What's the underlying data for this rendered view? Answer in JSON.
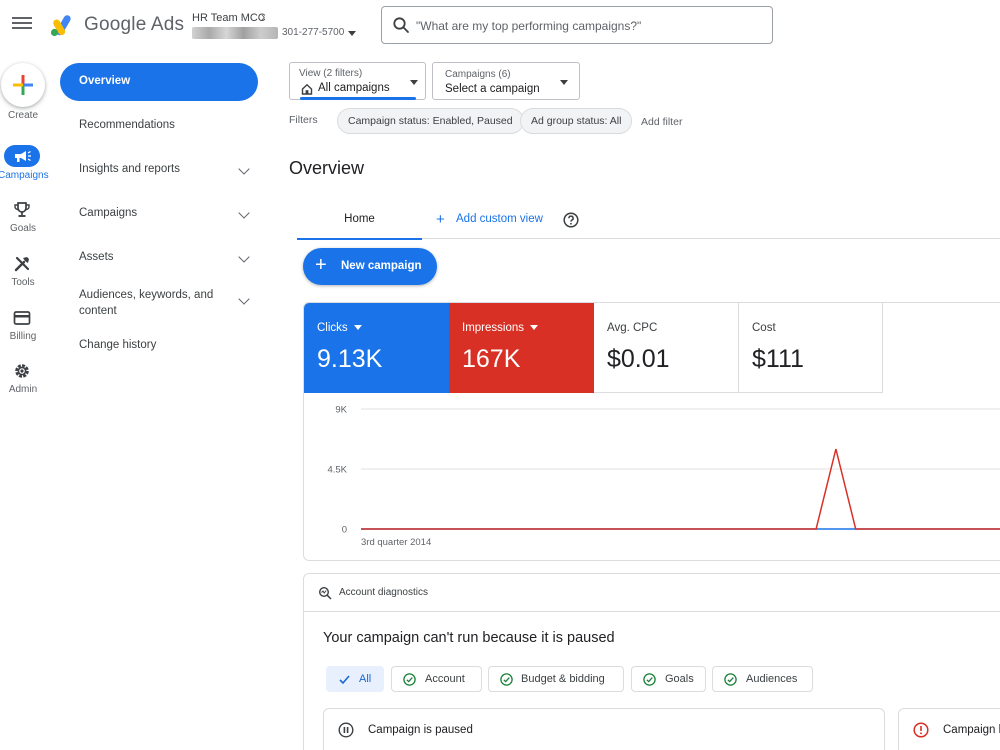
{
  "header": {
    "product_name": "Google Ads",
    "account_name": "HR Team MCC",
    "account_id": "301-277-5700",
    "search_placeholder": "\"What are my top performing campaigns?\""
  },
  "rail": {
    "create": "Create",
    "campaigns": "Campaigns",
    "goals": "Goals",
    "tools": "Tools",
    "billing": "Billing",
    "admin": "Admin"
  },
  "sidenav": {
    "items": [
      {
        "label": "Overview"
      },
      {
        "label": "Recommendations"
      },
      {
        "label": "Insights and reports"
      },
      {
        "label": "Campaigns"
      },
      {
        "label": "Assets"
      },
      {
        "label": "Audiences, keywords, and content"
      },
      {
        "label": "Change history"
      }
    ]
  },
  "selectors": {
    "view_label": "View (2 filters)",
    "view_value": "All campaigns",
    "campaigns_label": "Campaigns (6)",
    "campaigns_value": "Select a campaign"
  },
  "filters": {
    "label": "Filters",
    "chips": [
      "Campaign status: Enabled, Paused",
      "Ad group status: All"
    ],
    "add": "Add filter"
  },
  "page_title": "Overview",
  "tabs": {
    "home": "Home",
    "add_custom": "Add custom view"
  },
  "new_campaign": "New campaign",
  "metrics": [
    {
      "name": "Clicks",
      "value": "9.13K",
      "color": "#1a73e8"
    },
    {
      "name": "Impressions",
      "value": "167K",
      "color": "#d93025"
    },
    {
      "name": "Avg. CPC",
      "value": "$0.01"
    },
    {
      "name": "Cost",
      "value": "$111"
    }
  ],
  "chart_data": {
    "type": "line",
    "x_label_start": "3rd quarter 2014",
    "y_ticks": [
      "9K",
      "4.5K",
      "0"
    ],
    "ylim": [
      0,
      9000
    ],
    "series": [
      {
        "name": "Clicks",
        "color": "#1a73e8",
        "values": [
          0,
          0,
          0,
          0,
          0,
          0,
          0,
          0,
          0,
          0,
          0,
          0,
          0,
          0,
          0,
          0,
          0,
          0,
          0,
          0,
          0,
          0,
          0,
          0,
          0,
          0,
          0,
          0,
          0,
          0,
          0,
          0,
          0,
          0
        ]
      },
      {
        "name": "Impressions",
        "color": "#d93025",
        "values": [
          0,
          0,
          0,
          0,
          0,
          0,
          0,
          0,
          0,
          0,
          0,
          0,
          0,
          0,
          0,
          0,
          0,
          0,
          0,
          0,
          0,
          0,
          0,
          0,
          6000,
          0,
          0,
          0,
          0,
          0,
          0,
          0,
          0,
          0
        ]
      }
    ]
  },
  "diagnostics": {
    "title": "Account diagnostics",
    "message": "Your campaign can't run because it is paused",
    "chips": [
      "All",
      "Account",
      "Budget & bidding",
      "Goals",
      "Audiences"
    ],
    "issues": [
      "Campaign is paused",
      "Campaign b"
    ]
  }
}
